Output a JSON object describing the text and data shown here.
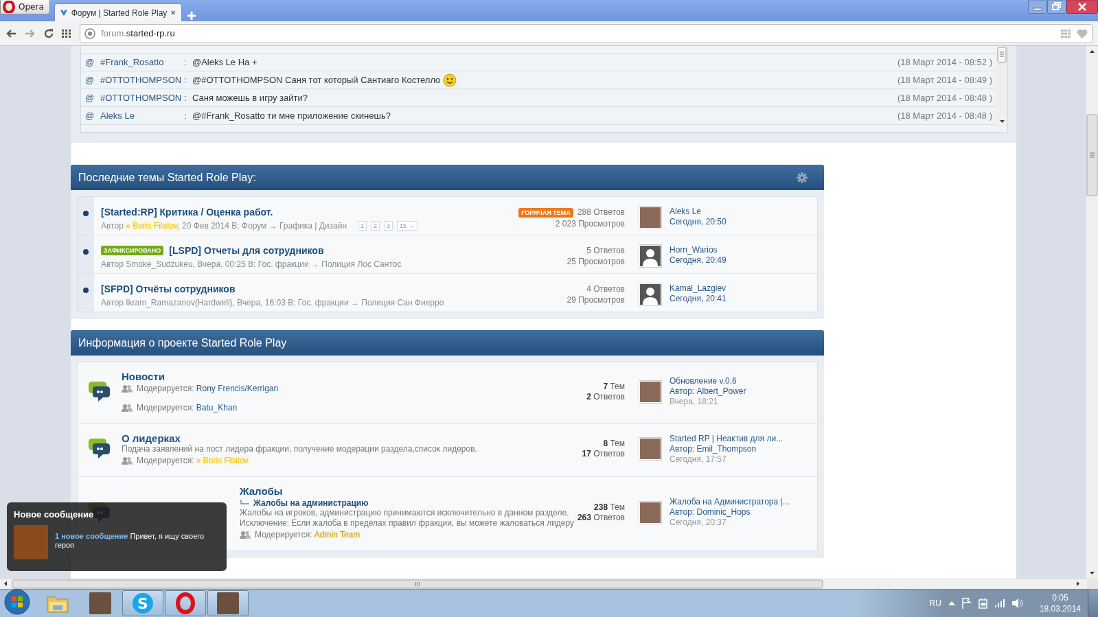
{
  "browser": {
    "opera_button": "Opera",
    "tabs": [
      {
        "title": "Форум | Started Role Play",
        "selected": true
      }
    ],
    "address": {
      "subdomain": "forum.",
      "domain": "started-rp.ru"
    }
  },
  "chat": {
    "messages": [
      {
        "mention": "@",
        "author": "#Frank_Rosatto",
        "separator": ":",
        "text": "@Aleks Le На +",
        "time": "(18 Март 2014 - 08:52 )",
        "emoticon": false
      },
      {
        "mention": "@",
        "author": "#OTTOTHOMPSON",
        "separator": ":",
        "text": "@#OTTOTHOMPSON Саня тот который Сантиаго Костелло",
        "time": "(18 Март 2014 - 08:49 )",
        "emoticon": true
      },
      {
        "mention": "@",
        "author": "#OTTOTHOMPSON",
        "separator": ":",
        "text": "Саня можешь в игру зайти?",
        "time": "(18 Март 2014 - 08:48 )",
        "emoticon": false
      },
      {
        "mention": "@",
        "author": "Aleks Le",
        "separator": ":",
        "text": "@#Frank_Rosatto ти мне приложение скинешь?",
        "time": "(18 Март 2014 - 08:48 )",
        "emoticon": false
      }
    ]
  },
  "topics": {
    "title": "Последние темы Started Role Play:",
    "items": [
      {
        "title": "[Started:RP] Критика / Оценка работ.",
        "badge": {
          "text": "ГОРЯЧАЯ ТЕМА",
          "kind": "hot"
        },
        "meta": {
          "prefix": "Автор ",
          "author": {
            "name": "» Boris Filatov",
            "kind": "admin"
          },
          "rest": ", 20 Фев 2014 В: Форум → Графика | Дизайн"
        },
        "pages": [
          "1",
          "2",
          "3",
          "15 →"
        ],
        "replies": "288 Ответов",
        "views": "2  023 Просмотров",
        "avatar": {
          "kind": "photo"
        },
        "last_author": "Aleks Le",
        "last_time": "Сегодня, 20:50"
      },
      {
        "title": "[LSPD] Отчеты для сотрудников",
        "badge": {
          "text": "ЗАФИКСИРОВАНО",
          "kind": "pinned"
        },
        "meta": {
          "prefix": "Автор ",
          "author": {
            "name": "Smoke_Sudzukeu",
            "kind": "normal"
          },
          "rest": ", Вчера, 00:25 В: Гос. фракции → Полиция Лос Сантос"
        },
        "replies": "5 Ответов",
        "views": "25 Просмотров",
        "avatar": {
          "kind": "default"
        },
        "last_author": "Horn_Warios",
        "last_time": "Сегодня, 20:49"
      },
      {
        "title": "[SFPD] Отчёты сотрудников",
        "meta": {
          "prefix": "Автор ",
          "author": {
            "name": "Ikram_Ramazanov(Hardwell)",
            "kind": "normal"
          },
          "rest": ", Вчера, 16:03 В: Гос. фракции → Полиция Сан Фиерро"
        },
        "replies": "4 Ответов",
        "views": "29 Просмотров",
        "avatar": {
          "kind": "default"
        },
        "last_author": "Kamal_Lazgiev",
        "last_time": "Сегодня, 20:41"
      }
    ]
  },
  "forums": {
    "title": "Информация о проекте Started Role Play",
    "items": [
      {
        "title": "Новости",
        "moderators": [
          {
            "label": "Модерируется: ",
            "name": "Rony Frencis/Kerrigan",
            "kind": "normal"
          },
          {
            "label": "Модерируется: ",
            "name": "Batu_Khan",
            "kind": "normal"
          }
        ],
        "topics": "**7** Тем",
        "replies": "**2** Ответов",
        "last": {
          "title": "Обновление v.0.6",
          "author": "Автор: Albert_Power",
          "time": "Вчера, 18:21"
        }
      },
      {
        "title": "О лидерках",
        "description": "Подача заявлений на пост лидера фракции, получение модерации раздела,список лидеров.",
        "moderators": [
          {
            "label": "Модерируется: ",
            "name": "» Boris Filatov",
            "kind": "admin"
          }
        ],
        "topics": "**8** Тем",
        "replies": "**17** Ответов",
        "last": {
          "title": "Started RP | Неактив для ли...",
          "author": "Автор: Emil_Thompson",
          "time": "Сегодня, 17:57"
        }
      },
      {
        "title": "Жалобы",
        "subforums": [
          "Жалобы на администрацию"
        ],
        "description": "Жалобы на игроков, администрацию принимаются исключительно в данном разделе. Исключение: Если жалоба в пределах правил фракции, вы можете жаловаться лидеру",
        "moderators": [
          {
            "label": "Модерируется: ",
            "name": "Admin Team",
            "kind": "team"
          }
        ],
        "topics": "**238** Тем",
        "replies": "**263** Ответов",
        "last": {
          "title": "Жалоба на Администратора |...",
          "author": "Автор: Dominic_Hops",
          "time": "Сегодня, 20:37"
        }
      }
    ]
  },
  "notification": {
    "title": "Новое сообщение",
    "link": "1 новое сообщение",
    "text": "Привет, я ищу своего героя"
  },
  "taskbar": {
    "items": [
      {
        "kind": "folder",
        "running": false
      },
      {
        "kind": "photo",
        "running": false
      },
      {
        "kind": "skype",
        "glyph": "S",
        "running": true
      },
      {
        "kind": "opera",
        "running": true
      },
      {
        "kind": "photo",
        "running": true
      }
    ],
    "tray": {
      "language": "RU",
      "time": "0:05",
      "date": "18.03.2014"
    }
  }
}
